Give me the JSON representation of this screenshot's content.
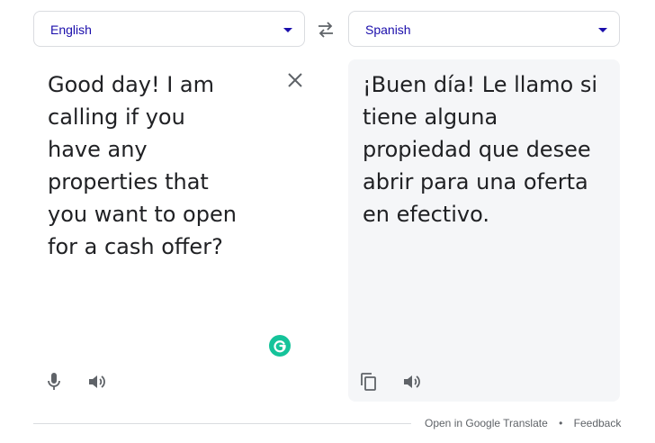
{
  "source": {
    "language": "English",
    "text": "Good day! I am calling if you have any properties that you want to open for a cash offer?"
  },
  "target": {
    "language": "Spanish",
    "text": "¡Buen día! Le llamo si tiene alguna propiedad que desee abrir para una oferta en efectivo."
  },
  "icons": {
    "swap": "swap-languages-icon",
    "clear": "close-icon",
    "grammarly": "grammarly-icon",
    "microphone": "microphone-icon",
    "speaker": "speaker-icon",
    "copy": "copy-icon"
  },
  "colors": {
    "language_label": "#1a0dab",
    "target_panel_bg": "#f5f6f8",
    "grammarly": "#15c39a"
  },
  "footer": {
    "open_link": "Open in Google Translate",
    "separator": "•",
    "feedback_link": "Feedback"
  }
}
